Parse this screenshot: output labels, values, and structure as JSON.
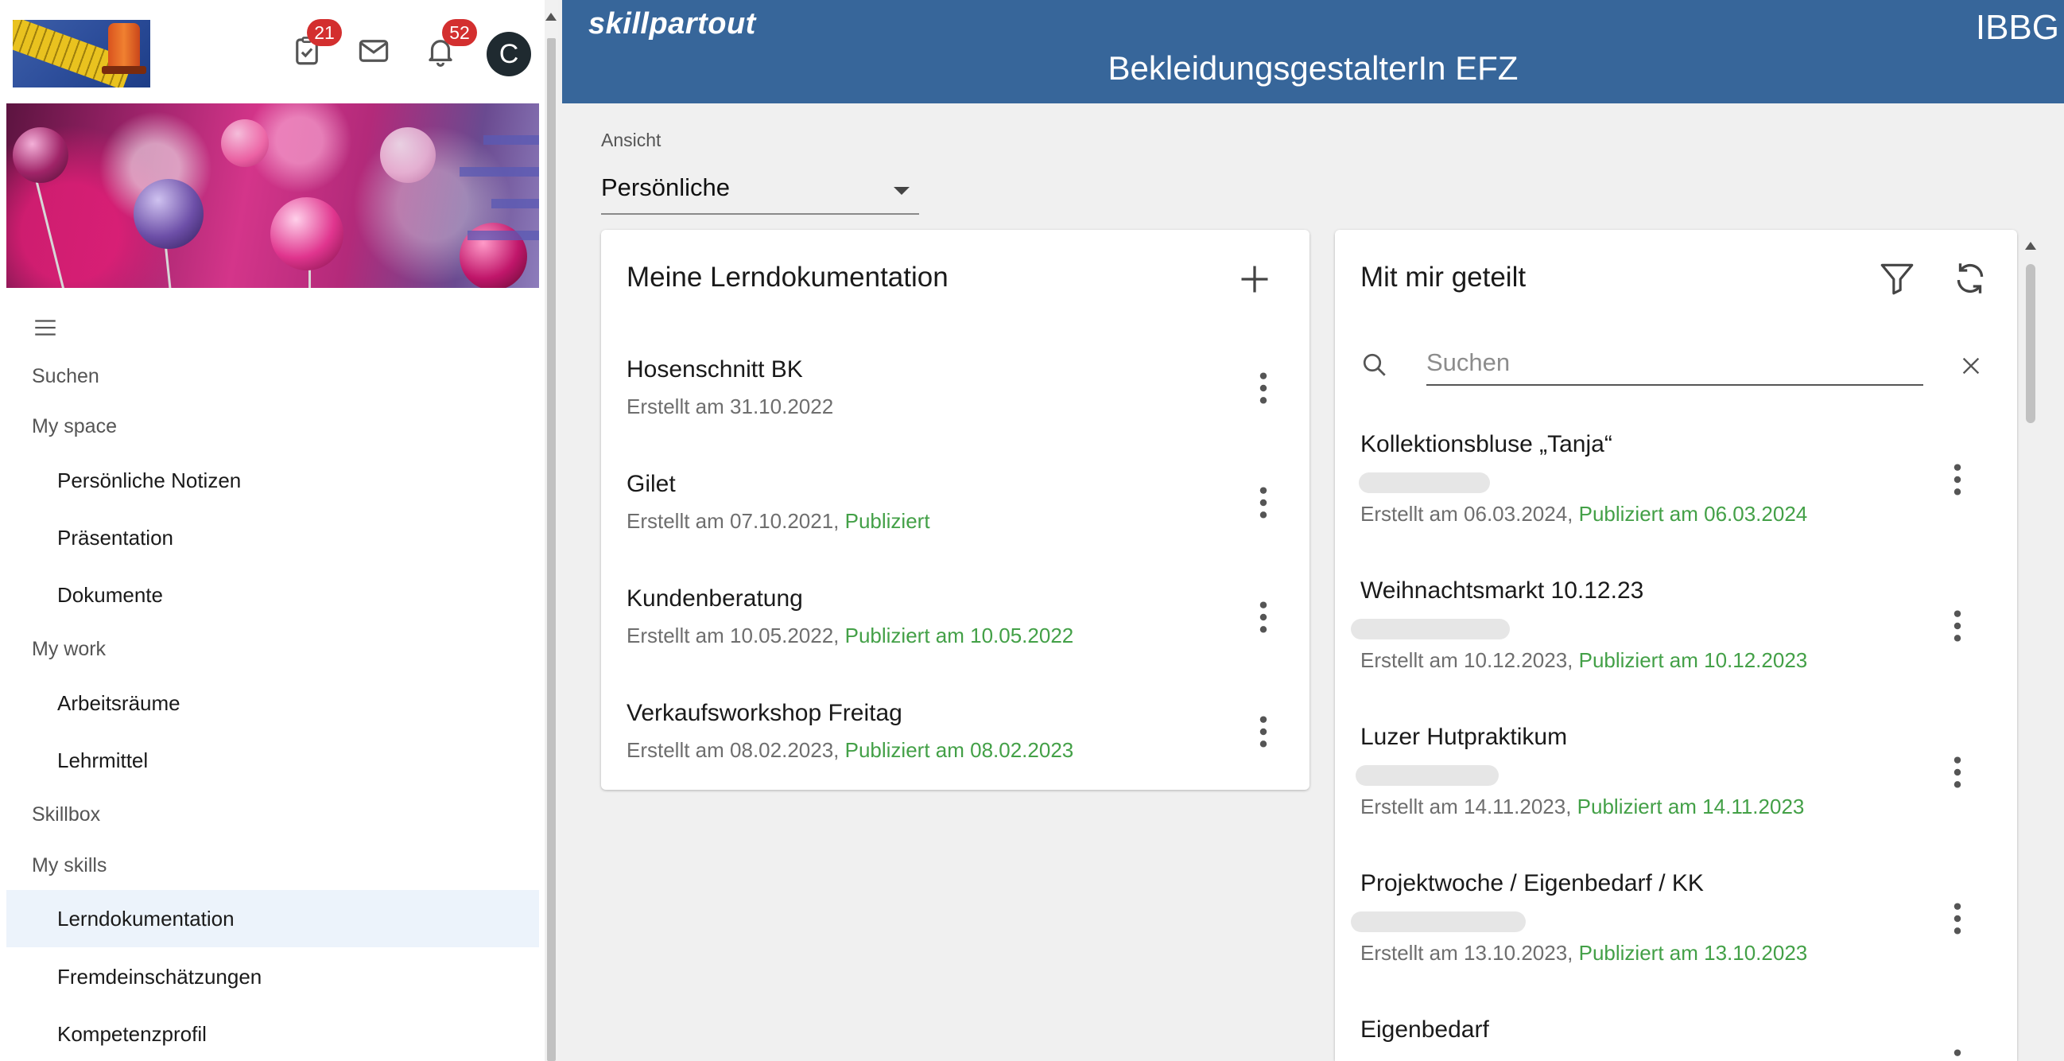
{
  "toolbar": {
    "tasks_badge": "21",
    "notifications_badge": "52",
    "avatar_initial": "C"
  },
  "header": {
    "brand": "skillpartout",
    "title": "BekleidungsgestalterIn EFZ",
    "organization": "IBBG"
  },
  "sidebar": {
    "items": [
      {
        "label": "Suchen"
      },
      {
        "label": "My space"
      },
      {
        "label": "Persönliche Notizen"
      },
      {
        "label": "Präsentation"
      },
      {
        "label": "Dokumente"
      },
      {
        "label": "My work"
      },
      {
        "label": "Arbeitsräume"
      },
      {
        "label": "Lehrmittel"
      },
      {
        "label": "Skillbox"
      },
      {
        "label": "My skills"
      },
      {
        "label": "Lerndokumentation"
      },
      {
        "label": "Fremdeinschätzungen"
      },
      {
        "label": "Kompetenzprofil"
      }
    ]
  },
  "view": {
    "label": "Ansicht",
    "selected": "Persönliche"
  },
  "my_docs": {
    "title": "Meine Lerndokumentation",
    "items": [
      {
        "title": "Hosenschnitt BK",
        "created": "Erstellt am 31.10.2022",
        "published": ""
      },
      {
        "title": "Gilet",
        "created": "Erstellt am 07.10.2021, ",
        "published": "Publiziert"
      },
      {
        "title": "Kundenberatung",
        "created": "Erstellt am 10.05.2022, ",
        "published": "Publiziert am 10.05.2022"
      },
      {
        "title": "Verkaufsworkshop Freitag",
        "created": "Erstellt am 08.02.2023, ",
        "published": "Publiziert am 08.02.2023"
      }
    ]
  },
  "shared": {
    "title": "Mit mir geteilt",
    "search_placeholder": "Suchen",
    "items": [
      {
        "title": "Kollektionsbluse „Tanja“",
        "created": "Erstellt am 06.03.2024, ",
        "published": "Publiziert am 06.03.2024"
      },
      {
        "title": "Weihnachtsmarkt 10.12.23",
        "created": "Erstellt am 10.12.2023, ",
        "published": "Publiziert am 10.12.2023"
      },
      {
        "title": "Luzer Hutpraktikum",
        "created": "Erstellt am 14.11.2023, ",
        "published": "Publiziert am 14.11.2023"
      },
      {
        "title": "Projektwoche / Eigenbedarf / KK",
        "created": "Erstellt am 13.10.2023, ",
        "published": "Publiziert am 13.10.2023"
      },
      {
        "title": "Eigenbedarf"
      }
    ]
  }
}
